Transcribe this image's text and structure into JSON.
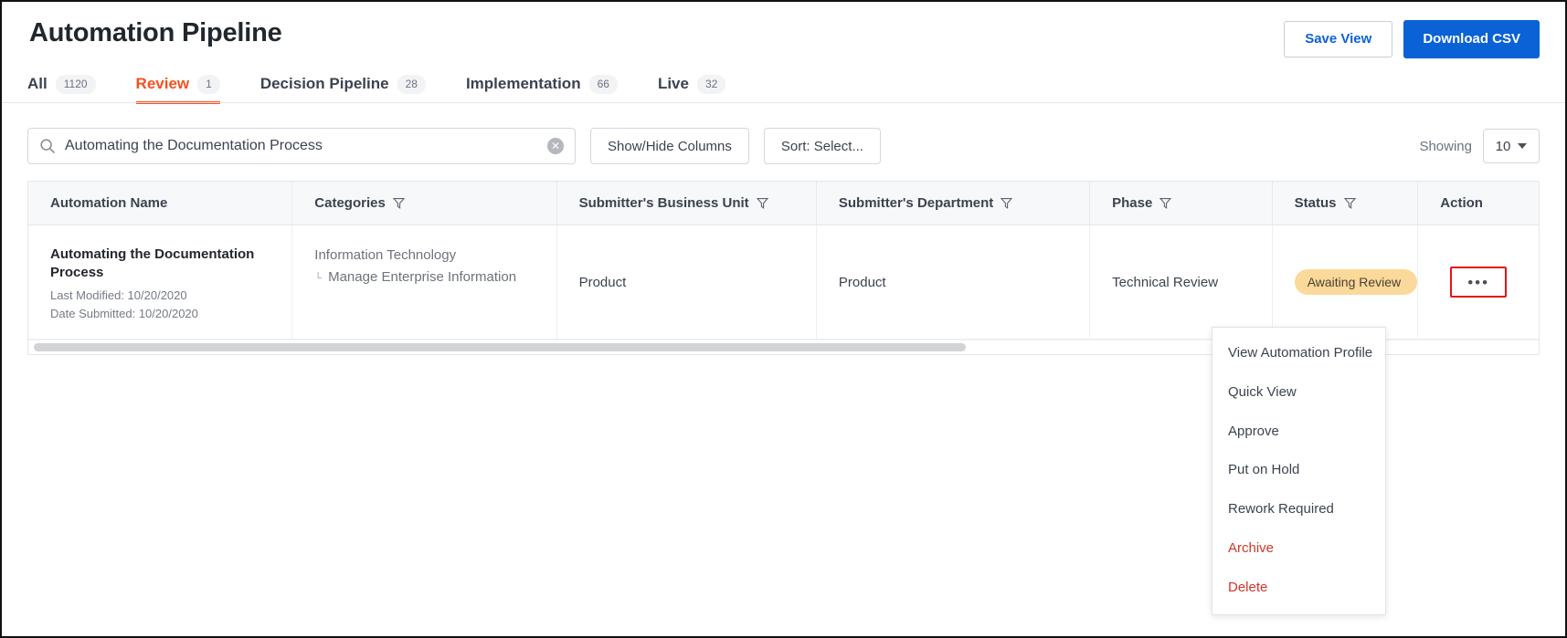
{
  "header": {
    "title": "Automation Pipeline",
    "save_view_label": "Save View",
    "download_csv_label": "Download CSV"
  },
  "tabs": [
    {
      "label": "All",
      "count": "1120",
      "active": false
    },
    {
      "label": "Review",
      "count": "1",
      "active": true
    },
    {
      "label": "Decision Pipeline",
      "count": "28",
      "active": false
    },
    {
      "label": "Implementation",
      "count": "66",
      "active": false
    },
    {
      "label": "Live",
      "count": "32",
      "active": false
    }
  ],
  "toolbar": {
    "search_value": "Automating the Documentation Process",
    "search_placeholder": "Search",
    "search_clear_glyph": "✕",
    "show_hide_columns_label": "Show/Hide Columns",
    "sort_label": "Sort: Select...",
    "showing_label": "Showing",
    "showing_value": "10"
  },
  "table": {
    "columns": [
      {
        "label": "Automation Name",
        "filter": false
      },
      {
        "label": "Categories",
        "filter": true
      },
      {
        "label": "Submitter's Business Unit",
        "filter": true
      },
      {
        "label": "Submitter's Department",
        "filter": true
      },
      {
        "label": "Phase",
        "filter": true
      },
      {
        "label": "Status",
        "filter": true
      },
      {
        "label": "Action",
        "filter": false
      }
    ],
    "row": {
      "name": "Automating the Documentation Process",
      "last_modified": "Last Modified: 10/20/2020",
      "date_submitted": "Date Submitted: 10/20/2020",
      "category_parent": "Information Technology",
      "category_child": "Manage Enterprise Information",
      "category_elbow": "└",
      "business_unit": "Product",
      "department": "Product",
      "phase": "Technical Review",
      "status": "Awaiting Review",
      "action_glyph": "•••"
    }
  },
  "action_menu": [
    {
      "label": "View Automation Profile",
      "danger": false
    },
    {
      "label": "Quick View",
      "danger": false
    },
    {
      "label": "Approve",
      "danger": false
    },
    {
      "label": "Put on Hold",
      "danger": false
    },
    {
      "label": "Rework Required",
      "danger": false
    },
    {
      "label": "Archive",
      "danger": true
    },
    {
      "label": "Delete",
      "danger": true
    }
  ],
  "colors": {
    "accent_orange": "#f4511e",
    "primary_blue": "#0b62d6",
    "status_amber": "#fbd99a",
    "danger_red": "#d0352b",
    "highlight_red": "#e4131b"
  }
}
